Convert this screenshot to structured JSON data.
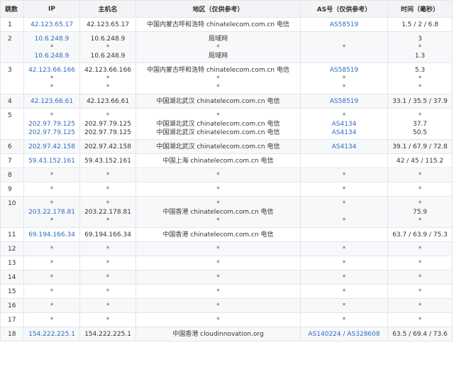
{
  "headers": {
    "hop": "跳数",
    "ip": "IP",
    "host": "主机名",
    "region": "地区（仅供参考）",
    "as": "AS号（仅供参考）",
    "time": "时间（毫秒）"
  },
  "rows": [
    {
      "hop": "1",
      "ip": [
        "42.123.65.17"
      ],
      "host": [
        "42.123.65.17"
      ],
      "region": [
        "中国内蒙古呼和浩特 chinatelecom.com.cn 电信"
      ],
      "as": [
        "AS58519"
      ],
      "time": [
        "1.5 / 2 / 6.8"
      ]
    },
    {
      "hop": "2",
      "ip": [
        "10.6.248.9",
        "*",
        "10.6.248.9"
      ],
      "host": [
        "10.6.248.9",
        "*",
        "10.6.248.9"
      ],
      "region": [
        "局域网",
        "*",
        "局域网"
      ],
      "as": [
        "",
        "*",
        ""
      ],
      "time": [
        "3",
        "*",
        "1.3"
      ]
    },
    {
      "hop": "3",
      "ip": [
        "42.123.66.166",
        "*",
        "*"
      ],
      "host": [
        "42.123.66.166",
        "*",
        "*"
      ],
      "region": [
        "中国内蒙古呼和浩特 chinatelecom.com.cn 电信",
        "*",
        "*"
      ],
      "as": [
        "AS58519",
        "*",
        "*"
      ],
      "time": [
        "5.3",
        "*",
        "*"
      ]
    },
    {
      "hop": "4",
      "ip": [
        "42.123.66.61"
      ],
      "host": [
        "42.123.66.61"
      ],
      "region": [
        "中国湖北武汉 chinatelecom.com.cn 电信"
      ],
      "as": [
        "AS58519"
      ],
      "time": [
        "33.1 / 35.5 / 37.9"
      ]
    },
    {
      "hop": "5",
      "ip": [
        "*",
        "202.97.79.125",
        "202.97.79.125"
      ],
      "host": [
        "*",
        "202.97.79.125",
        "202.97.79.125"
      ],
      "region": [
        "*",
        "中国湖北武汉 chinatelecom.com.cn 电信",
        "中国湖北武汉 chinatelecom.com.cn 电信"
      ],
      "as": [
        "*",
        "AS4134",
        "AS4134"
      ],
      "time": [
        "*",
        "37.7",
        "50.5"
      ]
    },
    {
      "hop": "6",
      "ip": [
        "202.97.42.158"
      ],
      "host": [
        "202.97.42.158"
      ],
      "region": [
        "中国湖北武汉 chinatelecom.com.cn 电信"
      ],
      "as": [
        "AS4134"
      ],
      "time": [
        "39.1 / 67.9 / 72.8"
      ]
    },
    {
      "hop": "7",
      "ip": [
        "59.43.152.161"
      ],
      "host": [
        "59.43.152.161"
      ],
      "region": [
        "中国上海 chinatelecom.com.cn 电信"
      ],
      "as": [
        ""
      ],
      "time": [
        "42 / 45 / 115.2"
      ]
    },
    {
      "hop": "8",
      "ip": [
        "*"
      ],
      "host": [
        "*"
      ],
      "region": [
        "*"
      ],
      "as": [
        "*"
      ],
      "time": [
        "*"
      ]
    },
    {
      "hop": "9",
      "ip": [
        "*"
      ],
      "host": [
        "*"
      ],
      "region": [
        "*"
      ],
      "as": [
        "*"
      ],
      "time": [
        "*"
      ]
    },
    {
      "hop": "10",
      "ip": [
        "*",
        "203.22.178.81",
        "*"
      ],
      "host": [
        "*",
        "203.22.178.81",
        "*"
      ],
      "region": [
        "*",
        "中国香港 chinatelecom.com.cn 电信",
        "*"
      ],
      "as": [
        "*",
        "",
        "*"
      ],
      "time": [
        "*",
        "75.9",
        "*"
      ]
    },
    {
      "hop": "11",
      "ip": [
        "69.194.166.34"
      ],
      "host": [
        "69.194.166.34"
      ],
      "region": [
        "中国香港 chinatelecom.com.cn 电信"
      ],
      "as": [
        ""
      ],
      "time": [
        "63.7 / 63.9 / 75.3"
      ]
    },
    {
      "hop": "12",
      "ip": [
        "*"
      ],
      "host": [
        "*"
      ],
      "region": [
        "*"
      ],
      "as": [
        "*"
      ],
      "time": [
        "*"
      ]
    },
    {
      "hop": "13",
      "ip": [
        "*"
      ],
      "host": [
        "*"
      ],
      "region": [
        "*"
      ],
      "as": [
        "*"
      ],
      "time": [
        "*"
      ]
    },
    {
      "hop": "14",
      "ip": [
        "*"
      ],
      "host": [
        "*"
      ],
      "region": [
        "*"
      ],
      "as": [
        "*"
      ],
      "time": [
        "*"
      ]
    },
    {
      "hop": "15",
      "ip": [
        "*"
      ],
      "host": [
        "*"
      ],
      "region": [
        "*"
      ],
      "as": [
        "*"
      ],
      "time": [
        "*"
      ]
    },
    {
      "hop": "16",
      "ip": [
        "*"
      ],
      "host": [
        "*"
      ],
      "region": [
        "*"
      ],
      "as": [
        "*"
      ],
      "time": [
        "*"
      ]
    },
    {
      "hop": "17",
      "ip": [
        "*"
      ],
      "host": [
        "*"
      ],
      "region": [
        "*"
      ],
      "as": [
        "*"
      ],
      "time": [
        "*"
      ]
    },
    {
      "hop": "18",
      "ip": [
        "154.222.225.1"
      ],
      "host": [
        "154.222.225.1"
      ],
      "region": [
        "中国香港 cloudinnovation.org"
      ],
      "as": [
        "AS140224 / AS328608"
      ],
      "time": [
        "63.5 / 69.4 / 73.6"
      ]
    }
  ]
}
